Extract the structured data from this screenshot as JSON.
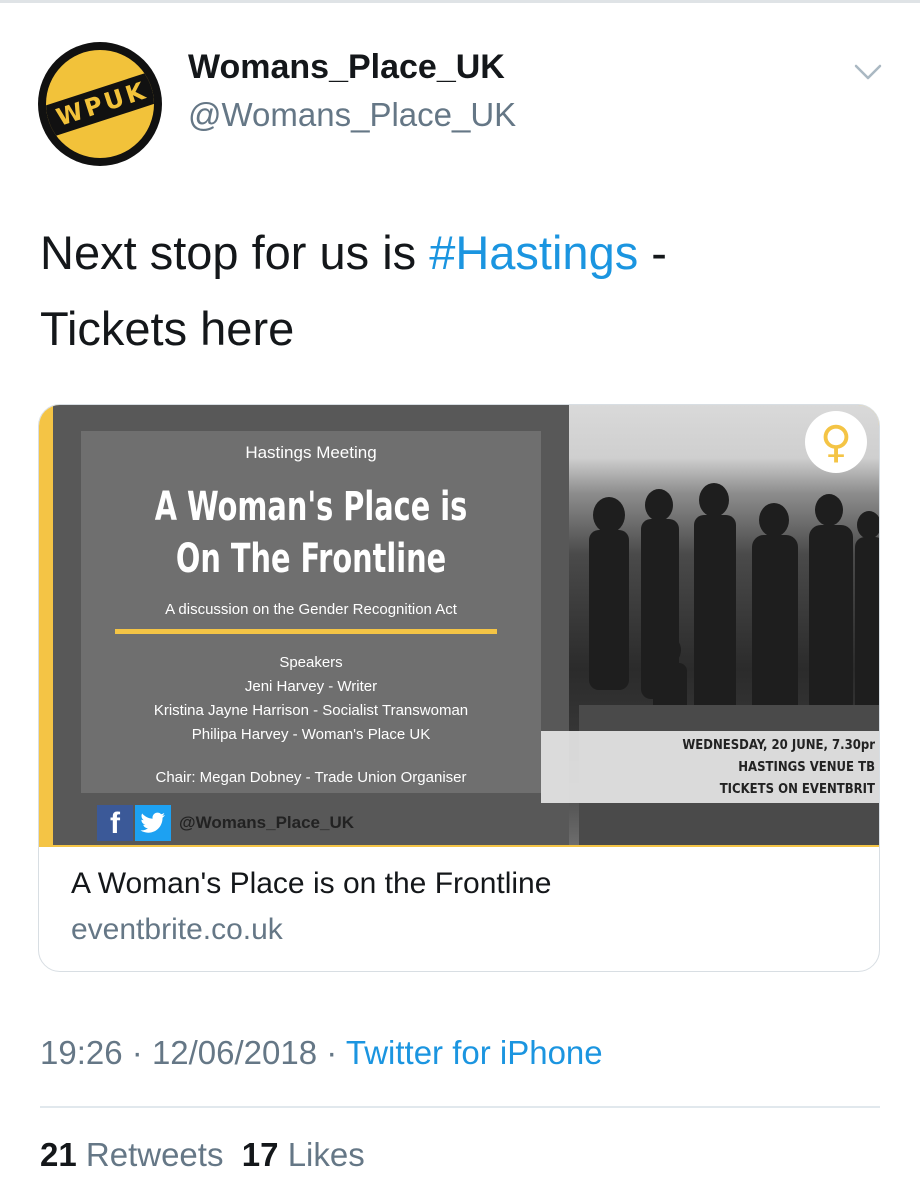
{
  "author": {
    "display_name": "Womans_Place_UK",
    "handle": "@Womans_Place_UK",
    "avatar_text": "WPUK"
  },
  "tweet": {
    "text_before": "Next stop for us is ",
    "hashtag": "#Hastings",
    "text_after": " -",
    "text_line2": "Tickets here"
  },
  "card": {
    "poster": {
      "meeting": "Hastings  Meeting",
      "title_line1": "A Woman's Place is",
      "title_line2": "On The Frontline",
      "subtitle": "A discussion on the Gender Recognition Act",
      "speakers_heading": "Speakers",
      "speakers": [
        "Jeni Harvey  - Writer",
        "Kristina Jayne Harrison  - Socialist Transwoman",
        "Philipa Harvey - Woman's Place UK"
      ],
      "chair": "Chair: Megan Dobney  - Trade Union Organiser",
      "event_lines": [
        "WEDNESDAY, 20 JUNE, 7.30pr",
        "HASTINGS VENUE TB",
        "TICKETS ON EVENTBRIT"
      ],
      "social_handle": "@Womans_Place_UK"
    },
    "title": "A Woman's Place is on the Frontline",
    "domain": "eventbrite.co.uk"
  },
  "meta": {
    "time": "19:26",
    "date": "12/06/2018",
    "separator": "·",
    "source": "Twitter for iPhone"
  },
  "stats": {
    "retweets_count": "21",
    "retweets_label": "Retweets",
    "likes_count": "17",
    "likes_label": "Likes"
  },
  "colors": {
    "link_blue": "#1b95e0",
    "secondary_text": "#657786",
    "poster_yellow": "#f4c445"
  },
  "icons": [
    "chevron-down-icon",
    "venus-icon",
    "facebook-icon",
    "twitter-icon"
  ]
}
